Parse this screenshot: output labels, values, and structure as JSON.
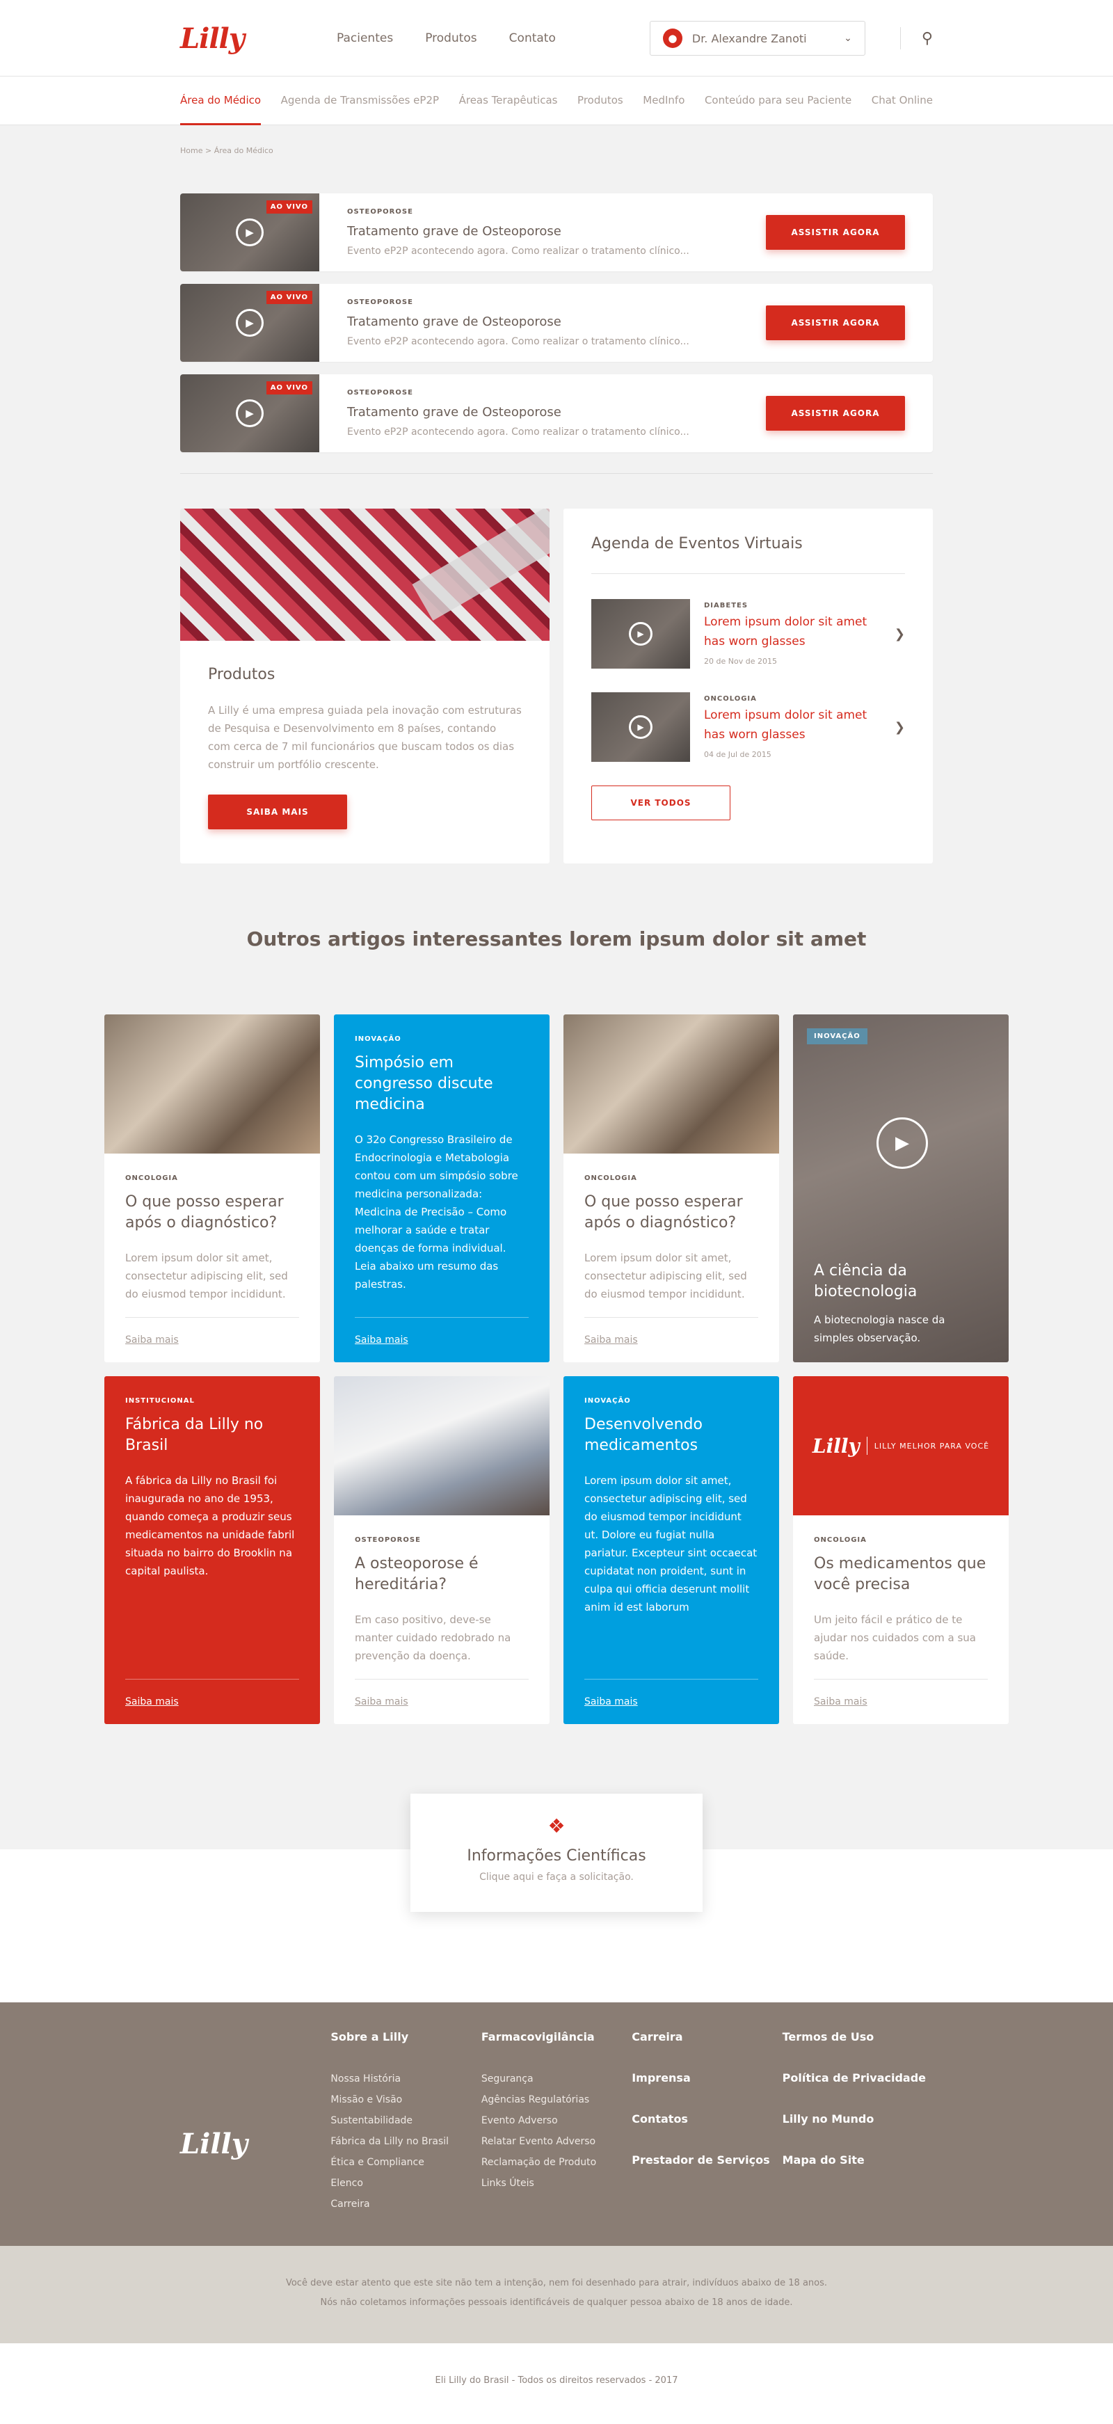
{
  "header": {
    "logo": "Lilly",
    "nav": [
      "Pacientes",
      "Produtos",
      "Contato"
    ],
    "user_name": "Dr. Alexandre Zanoti"
  },
  "subnav": [
    "Área do Médico",
    "Agenda de Transmissões eP2P",
    "Áreas Terapêuticas",
    "Produtos",
    "MedInfo",
    "Conteúdo para seu Paciente",
    "Chat Online"
  ],
  "breadcrumb": "Home > Área do Médico",
  "live": [
    {
      "badge": "AO VIVO",
      "category": "OSTEOPOROSE",
      "title": "Tratamento grave de Osteoporose",
      "desc": "Evento eP2P acontecendo agora. Como realizar o tratamento clínico...",
      "button": "ASSISTIR AGORA"
    },
    {
      "badge": "AO VIVO",
      "category": "OSTEOPOROSE",
      "title": "Tratamento grave de Osteoporose",
      "desc": "Evento eP2P acontecendo agora. Como realizar o tratamento clínico...",
      "button": "ASSISTIR AGORA"
    },
    {
      "badge": "AO VIVO",
      "category": "OSTEOPOROSE",
      "title": "Tratamento grave de Osteoporose",
      "desc": "Evento eP2P acontecendo agora. Como realizar o tratamento clínico...",
      "button": "ASSISTIR AGORA"
    }
  ],
  "produtos": {
    "title": "Produtos",
    "text": "A Lilly é uma empresa guiada pela inovação com estruturas de Pesquisa e Desenvolvimento em 8 países, contando com cerca de 7 mil funcionários que buscam todos os dias construir um portfólio crescente.",
    "button": "SAIBA MAIS"
  },
  "agenda": {
    "title": "Agenda de Eventos Virtuais",
    "events": [
      {
        "category": "DIABETES",
        "title": "Lorem ipsum dolor sit amet has worn glasses",
        "date": "20 de Nov de 2015"
      },
      {
        "category": "ONCOLOGIA",
        "title": "Lorem ipsum dolor sit amet has worn glasses",
        "date": "04 de Jul de 2015"
      }
    ],
    "button": "VER TODOS"
  },
  "articles_title": "Outros artigos interessantes lorem ipsum dolor sit amet",
  "articles": [
    {
      "category": "ONCOLOGIA",
      "title": "O que posso esperar após o diagnóstico?",
      "text": "Lorem ipsum dolor sit amet, consectetur adipiscing elit, sed do eiusmod tempor incididunt.",
      "link": "Saiba mais"
    },
    {
      "category": "INOVAÇÃO",
      "title": "Simpósio em congresso discute medicina",
      "text": "O 32o Congresso Brasileiro de Endocrinologia e Metabologia contou com um simpósio sobre medicina personalizada: Medicina de Precisão – Como melhorar a saúde e tratar doenças de forma individual. Leia abaixo um resumo das palestras.",
      "link": "Saiba mais"
    },
    {
      "category": "ONCOLOGIA",
      "title": "O que posso esperar após o diagnóstico?",
      "text": "Lorem ipsum dolor sit amet, consectetur adipiscing elit, sed do eiusmod tempor incididunt.",
      "link": "Saiba mais"
    },
    {
      "category": "INOVAÇÃO",
      "title": "A ciência da biotecnologia",
      "text": "A biotecnologia nasce da simples observação.",
      "link": ""
    },
    {
      "category": "INSTITUCIONAL",
      "title": "Fábrica da Lilly no Brasil",
      "text": "A fábrica da Lilly no Brasil foi inaugurada no ano de 1953, quando começa a produzir seus medicamentos na unidade fabril situada no bairro do Brooklin na capital paulista.",
      "link": "Saiba mais"
    },
    {
      "category": "OSTEOPOROSE",
      "title": "A osteoporose é hereditária?",
      "text": "Em caso positivo, deve-se manter cuidado redobrado na prevenção da doença.",
      "link": "Saiba mais"
    },
    {
      "category": "INOVAÇÃO",
      "title": "Desenvolvendo medicamentos",
      "text": "Lorem ipsum dolor sit amet, consectetur adipiscing elit, sed do eiusmod tempor incididunt ut. Dolore eu fugiat nulla pariatur. Excepteur sint occaecat cupidatat non proident, sunt in culpa qui officia deserunt mollit anim id est laborum",
      "link": "Saiba mais"
    },
    {
      "category": "ONCOLOGIA",
      "title": "Os medicamentos que você precisa",
      "text": "Um jeito fácil e prático de te ajudar nos cuidados com a sua saúde.",
      "link": "Saiba mais",
      "brand_logo": "Lilly",
      "brand_tag": "LILLY MELHOR PARA VOCÊ"
    }
  ],
  "info": {
    "title": "Informações Científicas",
    "sub": "Clique aqui e faça a solicitação."
  },
  "footer": {
    "logo": "Lilly",
    "col1": {
      "head": "Sobre a Lilly",
      "links": [
        "Nossa História",
        "Missão e Visão",
        "Sustentabilidade",
        "Fábrica da Lilly no Brasil",
        "Ética e Compliance",
        "Elenco",
        "Carreira"
      ]
    },
    "col2": {
      "head": "Farmacovigilância",
      "links": [
        "Segurança",
        "Agências Regulatórias",
        "Evento Adverso",
        "Relatar Evento Adverso",
        "Reclamação de Produto",
        "Links Úteis"
      ]
    },
    "col3": [
      "Carreira",
      "Imprensa",
      "Contatos",
      "Prestador de Serviços"
    ],
    "col4": [
      "Termos de Uso",
      "Política de Privacidade",
      "Lilly no Mundo",
      "Mapa do Site"
    ]
  },
  "disclaimer": [
    "Você deve estar atento que este site não tem a intenção, nem foi desenhado para atrair, indivíduos abaixo de 18 anos.",
    "Nós não coletamos informações pessoais identificáveis de qualquer pessoa abaixo de 18 anos de idade."
  ],
  "copyright": "Eli Lilly do Brasil - Todos os direitos reservados - 2017",
  "colors": {
    "brand_red": "#d52b1e",
    "blue": "#009fdf",
    "footer_brown": "#8a7d74"
  }
}
